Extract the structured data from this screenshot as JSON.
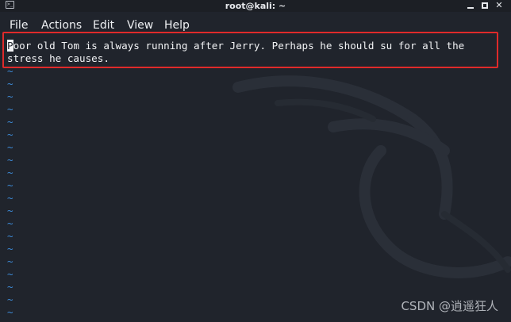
{
  "window": {
    "title": "root@kali: ~",
    "controls": {
      "minimize": "minimize",
      "maximize": "maximize",
      "close": "✕"
    }
  },
  "menubar": {
    "items": [
      "File",
      "Actions",
      "Edit",
      "View",
      "Help"
    ]
  },
  "editor": {
    "cursor_char": "P",
    "line1_rest": "oor old Tom is always running after Jerry. Perhaps he should su for all the",
    "line2": "stress he causes.",
    "empty_line_marker": "~",
    "empty_line_count": 20
  },
  "colors": {
    "background": "#20242c",
    "text": "#f2f3f5",
    "tilde": "#3d8bd8",
    "highlight_box": "#e02a2a"
  },
  "watermark": {
    "text": "CSDN @逍遥狂人"
  }
}
